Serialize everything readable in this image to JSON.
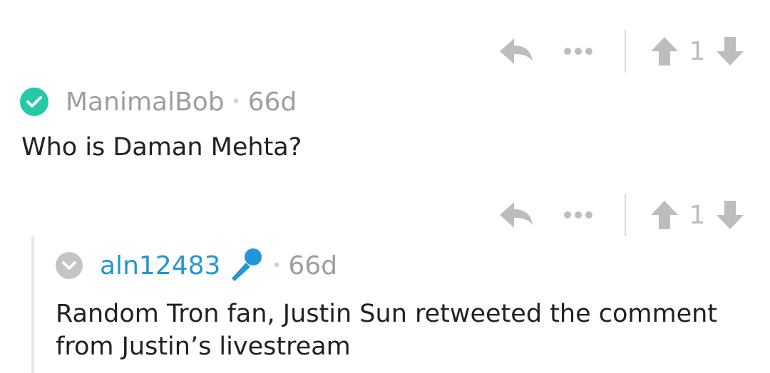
{
  "comments": [
    {
      "username": "ManimalBob",
      "separator": "•",
      "age": "66d",
      "text": "Who is Daman Mehta?",
      "score": "1",
      "badge_color": "#24c9a8",
      "badge_icon": "checkmark-icon"
    },
    {
      "username": "aln12483",
      "separator": "•",
      "age": "66d",
      "text": "Random Tron fan, Justin Sun retweeted the comment from Justin’s livestream",
      "score": "1",
      "badge_color": "#c4c4c4",
      "badge_icon": "chevron-down-icon",
      "flair_icon": "microphone-icon",
      "username_color": "#2196d8"
    }
  ]
}
